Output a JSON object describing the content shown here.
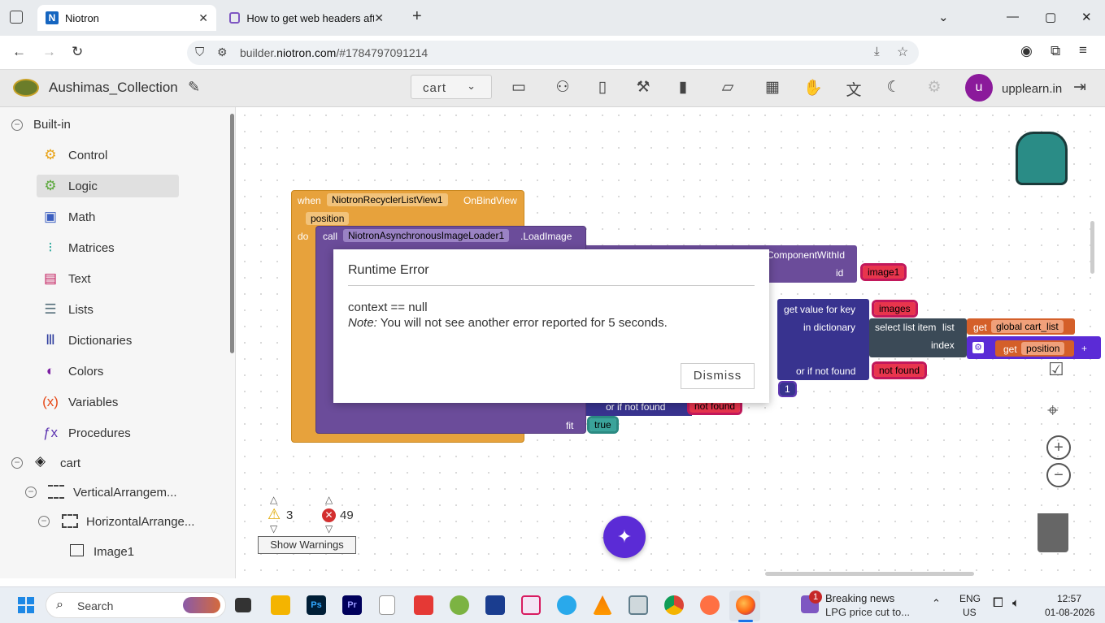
{
  "browser": {
    "tabs": [
      {
        "label": "Niotron",
        "close": "✕"
      },
      {
        "label": "How to get web headers after s",
        "close": "✕"
      }
    ],
    "new_tab": "+",
    "url_prefix": "builder.",
    "url_domain": "niotron.com",
    "url_suffix": "/#1784797091214"
  },
  "app": {
    "project_name": "Aushimas_Collection",
    "screen": "cart",
    "user_initial": "u",
    "user_name": "upplearn.in"
  },
  "sidebar": {
    "builtin_label": "Built-in",
    "items": [
      {
        "label": "Control",
        "icon": "gear-icon",
        "color": "#e8a317"
      },
      {
        "label": "Logic",
        "icon": "logic-icon",
        "color": "#5aa83b"
      },
      {
        "label": "Math",
        "icon": "calculator-icon",
        "color": "#3b5ec0"
      },
      {
        "label": "Matrices",
        "icon": "matrix-icon",
        "color": "#26a69a"
      },
      {
        "label": "Text",
        "icon": "text-icon",
        "color": "#c2185b"
      },
      {
        "label": "Lists",
        "icon": "list-icon",
        "color": "#546e7a"
      },
      {
        "label": "Dictionaries",
        "icon": "books-icon",
        "color": "#303f9f"
      },
      {
        "label": "Colors",
        "icon": "drop-icon",
        "color": "#7b1fa2"
      },
      {
        "label": "Variables",
        "icon": "variable-icon",
        "color": "#e64a19"
      },
      {
        "label": "Procedures",
        "icon": "function-icon",
        "color": "#5e35b1"
      }
    ],
    "tree": [
      {
        "label": "cart"
      },
      {
        "label": "VerticalArrangem..."
      },
      {
        "label": "HorizontalArrange..."
      },
      {
        "label": "Image1"
      }
    ]
  },
  "blocks": {
    "when": "when",
    "event_component": "NiotronRecyclerListView1",
    "event_name": "OnBindView",
    "param": "position",
    "do": "do",
    "call": "call",
    "call_component": "NiotronAsynchronousImageLoader1",
    "call_method": ".LoadImage",
    "get_component": "ComponentWithId",
    "id_label": "id",
    "id_value": "image1",
    "get_value_for_key": "get value for key",
    "key_value": "images",
    "in_dictionary": "in dictionary",
    "select_list_item": "select list item",
    "list_label": "list",
    "get1": "get",
    "global_var": "global cart_list",
    "index_label": "index",
    "get2": "get",
    "position_var": "position",
    "plus": "+",
    "or_if_not_found": "or if not found",
    "not_found_1": "not found",
    "num_one": "1",
    "or_if_not_found_2": "or if not found",
    "not_found_2": "not found",
    "fit_label": "fit",
    "fit_value": "true"
  },
  "counters": {
    "warnings": "3",
    "errors": "49",
    "show_warnings": "Show Warnings"
  },
  "dialog": {
    "title": "Runtime Error",
    "message": "context == null",
    "note_label": "Note:",
    "note_text": " You will not see another error reported for 5 seconds.",
    "dismiss": "Dismiss"
  },
  "taskbar": {
    "search": "Search",
    "news_badge": "1",
    "news_title": "Breaking news",
    "news_sub": "LPG price cut to...",
    "lang1": "ENG",
    "lang2": "US",
    "time": "12:57",
    "date": "01-08-2026"
  }
}
